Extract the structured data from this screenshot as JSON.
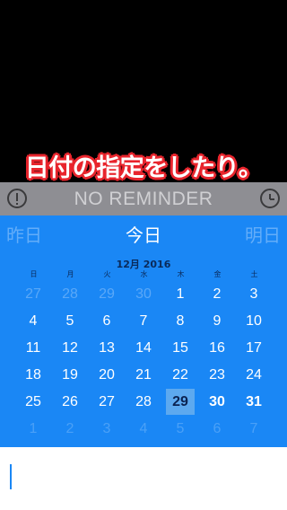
{
  "overlay_caption": "日付の指定をしたり。",
  "reminder": {
    "label": "NO REMINDER",
    "left_icon": "exclamation-circle-icon",
    "right_icon": "clock-icon"
  },
  "day_nav": {
    "prev": "昨日",
    "today": "今日",
    "next": "明日"
  },
  "calendar": {
    "month_title": "12月 2016",
    "weekdays": [
      "日",
      "月",
      "火",
      "水",
      "木",
      "金",
      "土"
    ],
    "weeks": [
      [
        {
          "d": "27",
          "s": "faded"
        },
        {
          "d": "28",
          "s": "faded"
        },
        {
          "d": "29",
          "s": "faded"
        },
        {
          "d": "30",
          "s": "faded"
        },
        {
          "d": "1",
          "s": ""
        },
        {
          "d": "2",
          "s": ""
        },
        {
          "d": "3",
          "s": ""
        }
      ],
      [
        {
          "d": "4",
          "s": ""
        },
        {
          "d": "5",
          "s": ""
        },
        {
          "d": "6",
          "s": ""
        },
        {
          "d": "7",
          "s": ""
        },
        {
          "d": "8",
          "s": ""
        },
        {
          "d": "9",
          "s": ""
        },
        {
          "d": "10",
          "s": ""
        }
      ],
      [
        {
          "d": "11",
          "s": ""
        },
        {
          "d": "12",
          "s": ""
        },
        {
          "d": "13",
          "s": ""
        },
        {
          "d": "14",
          "s": ""
        },
        {
          "d": "15",
          "s": ""
        },
        {
          "d": "16",
          "s": ""
        },
        {
          "d": "17",
          "s": ""
        }
      ],
      [
        {
          "d": "18",
          "s": ""
        },
        {
          "d": "19",
          "s": ""
        },
        {
          "d": "20",
          "s": ""
        },
        {
          "d": "21",
          "s": ""
        },
        {
          "d": "22",
          "s": ""
        },
        {
          "d": "23",
          "s": ""
        },
        {
          "d": "24",
          "s": ""
        }
      ],
      [
        {
          "d": "25",
          "s": ""
        },
        {
          "d": "26",
          "s": ""
        },
        {
          "d": "27",
          "s": ""
        },
        {
          "d": "28",
          "s": ""
        },
        {
          "d": "29",
          "s": "selected"
        },
        {
          "d": "30",
          "s": "bold"
        },
        {
          "d": "31",
          "s": "bold"
        }
      ],
      [
        {
          "d": "1",
          "s": "next"
        },
        {
          "d": "2",
          "s": "next"
        },
        {
          "d": "3",
          "s": "next"
        },
        {
          "d": "4",
          "s": "next"
        },
        {
          "d": "5",
          "s": "next"
        },
        {
          "d": "6",
          "s": "next"
        },
        {
          "d": "7",
          "s": "next"
        }
      ]
    ],
    "selected_date": "29"
  },
  "colors": {
    "calendar_bg": "#1a87f5",
    "reminder_bg": "#8e8e93",
    "caption_outline": "#e8252d",
    "selected_bg": "#5da9ef"
  }
}
